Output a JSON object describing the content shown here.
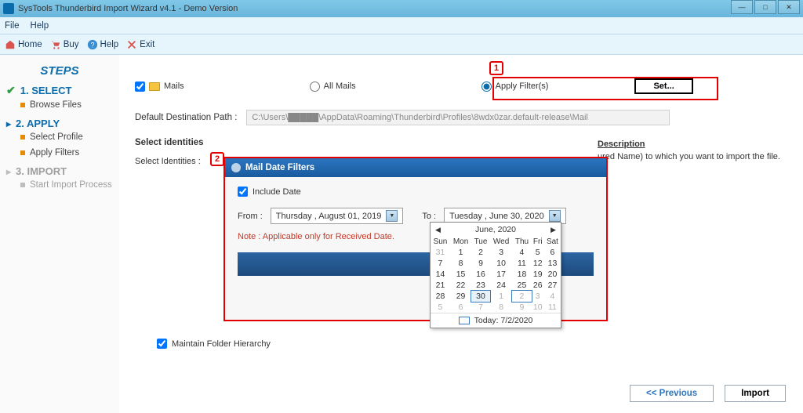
{
  "window": {
    "title": "SysTools Thunderbird Import Wizard v4.1 - Demo Version"
  },
  "menubar": {
    "file": "File",
    "help": "Help"
  },
  "toolbar": {
    "home": "Home",
    "buy": "Buy",
    "thelp": "Help",
    "exit": "Exit"
  },
  "sidebar": {
    "title": "STEPS",
    "step1": {
      "label": "1. SELECT",
      "sub": [
        "Browse Files"
      ]
    },
    "step2": {
      "label": "2. APPLY",
      "sub": [
        "Select Profile",
        "Apply Filters"
      ]
    },
    "step3": {
      "label": "3. IMPORT",
      "sub": [
        "Start Import Process"
      ]
    }
  },
  "mails": {
    "checkbox": "Mails",
    "all": "All Mails",
    "filter": "Apply Filter(s)",
    "set": "Set..."
  },
  "dest": {
    "label": "Default Destination Path :",
    "value": "C:\\Users\\█████\\AppData\\Roaming\\Thunderbird\\Profiles\\8wdx0zar.default-release\\Mail"
  },
  "identities": {
    "section": "Select identities",
    "label": "Select Identities :",
    "desc_h": "Description",
    "desc_body": "ured Name) to   which  you want to import the file."
  },
  "dialog": {
    "title": "Mail Date Filters",
    "include": "Include Date",
    "from_lbl": "From :",
    "from_val": "Thursday  ,    August   01, 2019",
    "to_lbl": "To :",
    "to_val": "Tuesday   ,      June      30, 2020",
    "note": "Note : Applicable only for Received Date."
  },
  "calendar": {
    "month": "June, 2020",
    "dow": [
      "Sun",
      "Mon",
      "Tue",
      "Wed",
      "Thu",
      "Fri",
      "Sat"
    ],
    "rows": [
      [
        {
          "n": 31,
          "dim": true
        },
        {
          "n": 1
        },
        {
          "n": 2
        },
        {
          "n": 3
        },
        {
          "n": 4
        },
        {
          "n": 5
        },
        {
          "n": 6
        }
      ],
      [
        {
          "n": 7
        },
        {
          "n": 8
        },
        {
          "n": 9
        },
        {
          "n": 10
        },
        {
          "n": 11
        },
        {
          "n": 12
        },
        {
          "n": 13
        }
      ],
      [
        {
          "n": 14
        },
        {
          "n": 15
        },
        {
          "n": 16
        },
        {
          "n": 17
        },
        {
          "n": 18
        },
        {
          "n": 19
        },
        {
          "n": 20
        }
      ],
      [
        {
          "n": 21
        },
        {
          "n": 22
        },
        {
          "n": 23
        },
        {
          "n": 24
        },
        {
          "n": 25
        },
        {
          "n": 26
        },
        {
          "n": 27
        }
      ],
      [
        {
          "n": 28
        },
        {
          "n": 29
        },
        {
          "n": 30,
          "sel": true
        },
        {
          "n": 1,
          "dim": true
        },
        {
          "n": 2,
          "dim": true,
          "today": true
        },
        {
          "n": 3,
          "dim": true
        },
        {
          "n": 4,
          "dim": true
        }
      ],
      [
        {
          "n": 5,
          "dim": true
        },
        {
          "n": 6,
          "dim": true
        },
        {
          "n": 7,
          "dim": true
        },
        {
          "n": 8,
          "dim": true
        },
        {
          "n": 9,
          "dim": true
        },
        {
          "n": 10,
          "dim": true
        },
        {
          "n": 11,
          "dim": true
        }
      ]
    ],
    "today": "Today: 7/2/2020"
  },
  "maintain": "Maintain Folder Hierarchy",
  "footer": {
    "prev": "<< Previous",
    "import": "Import"
  },
  "callouts": {
    "c1": "1",
    "c2": "2"
  }
}
